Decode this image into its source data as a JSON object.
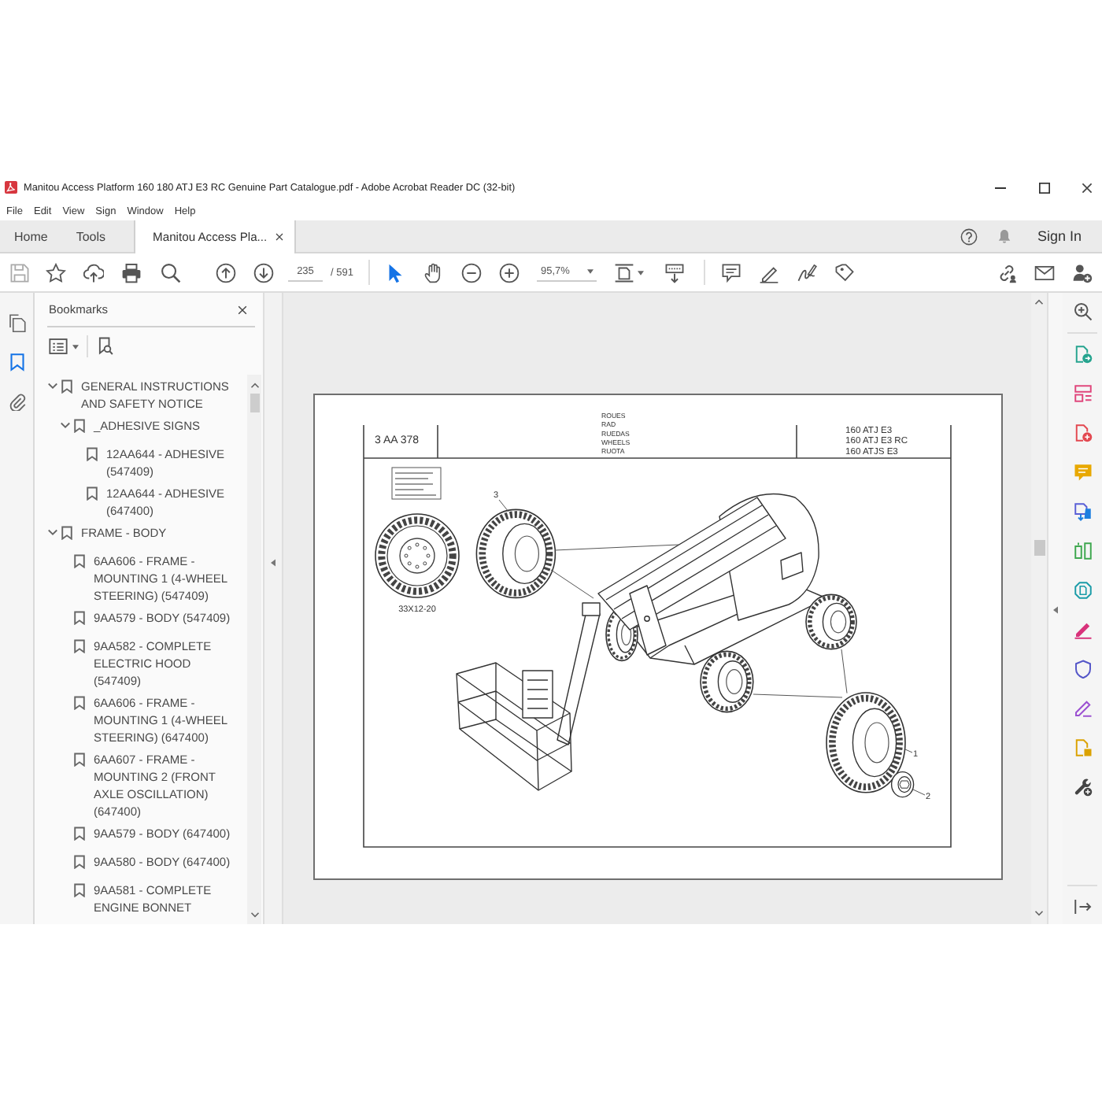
{
  "window": {
    "title": "Manitou Access Platform 160 180 ATJ E3 RC Genuine Part Catalogue.pdf - Adobe Acrobat Reader DC (32-bit)"
  },
  "menu": [
    "File",
    "Edit",
    "View",
    "Sign",
    "Window",
    "Help"
  ],
  "tabs": [
    {
      "label": "Home",
      "kind": "tool",
      "selected": false
    },
    {
      "label": "Tools",
      "kind": "tool",
      "selected": false
    },
    {
      "label": "Manitou Access Pla...",
      "kind": "document",
      "selected": true
    }
  ],
  "account": {
    "sign_in": "Sign In"
  },
  "toolbar": {
    "page_number": "235",
    "page_count": "/ 591",
    "zoom": "95,7%",
    "tools": [
      {
        "kind": "select",
        "selected": true
      },
      {
        "kind": "hand",
        "selected": false
      }
    ]
  },
  "nav_rail": [
    {
      "kind": "pages",
      "selected": false
    },
    {
      "kind": "bookmarks",
      "selected": true
    },
    {
      "kind": "attachments",
      "selected": false
    }
  ],
  "bookmarks": {
    "title": "Bookmarks",
    "items": [
      {
        "label": "GENERAL INSTRUCTIONS AND SAFETY NOTICE",
        "expanded": true,
        "children": [
          {
            "label": "_ADHESIVE SIGNS",
            "expanded": true,
            "children": [
              {
                "label": "12AA644 - ADHESIVE (547409)"
              },
              {
                "label": "12AA644 - ADHESIVE (647400)"
              }
            ]
          }
        ]
      },
      {
        "label": "FRAME - BODY",
        "expanded": true,
        "children": [
          {
            "label": "6AA606 - FRAME - MOUNTING 1 (4-WHEEL STEERING) (547409)"
          },
          {
            "label": "9AA579 - BODY (547409)"
          },
          {
            "label": "9AA582 - COMPLETE ELECTRIC HOOD (547409)"
          },
          {
            "label": "6AA606 - FRAME - MOUNTING 1 (4-WHEEL STEERING) (647400)"
          },
          {
            "label": "6AA607 - FRAME - MOUNTING 2 (FRONT AXLE OSCILLATION) (647400)"
          },
          {
            "label": "9AA579 - BODY (647400)"
          },
          {
            "label": "9AA580 - BODY (647400)"
          },
          {
            "label": "9AA581 - COMPLETE ENGINE BONNET"
          }
        ]
      }
    ]
  },
  "document": {
    "drawing_number": "3 AA 378",
    "titles": [
      "ROUES",
      "RAD",
      "RUEDAS",
      "WHEELS",
      "RUOTA"
    ],
    "models": [
      "160 ATJ E3",
      "160 ATJ E3 RC",
      "160 ATJS E3"
    ],
    "tyre_size": "33X12-20",
    "callouts": [
      "3",
      "1",
      "2"
    ]
  }
}
